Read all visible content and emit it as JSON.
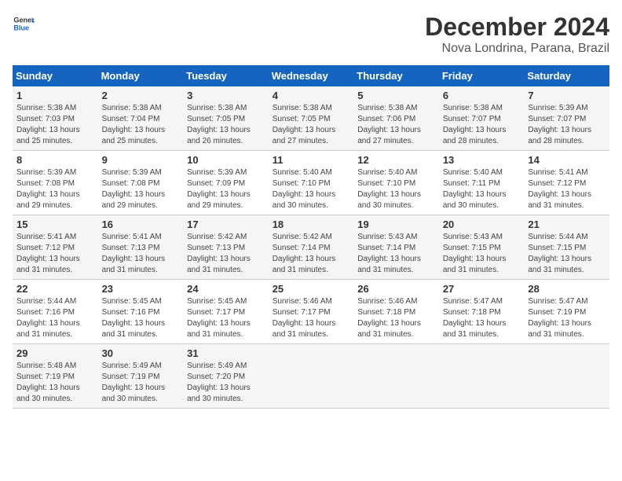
{
  "header": {
    "logo_line1": "General",
    "logo_line2": "Blue",
    "month_title": "December 2024",
    "location": "Nova Londrina, Parana, Brazil"
  },
  "weekdays": [
    "Sunday",
    "Monday",
    "Tuesday",
    "Wednesday",
    "Thursday",
    "Friday",
    "Saturday"
  ],
  "weeks": [
    [
      {
        "day": "1",
        "sunrise": "5:38 AM",
        "sunset": "7:03 PM",
        "daylight": "13 hours and 25 minutes."
      },
      {
        "day": "2",
        "sunrise": "5:38 AM",
        "sunset": "7:04 PM",
        "daylight": "13 hours and 25 minutes."
      },
      {
        "day": "3",
        "sunrise": "5:38 AM",
        "sunset": "7:05 PM",
        "daylight": "13 hours and 26 minutes."
      },
      {
        "day": "4",
        "sunrise": "5:38 AM",
        "sunset": "7:05 PM",
        "daylight": "13 hours and 27 minutes."
      },
      {
        "day": "5",
        "sunrise": "5:38 AM",
        "sunset": "7:06 PM",
        "daylight": "13 hours and 27 minutes."
      },
      {
        "day": "6",
        "sunrise": "5:38 AM",
        "sunset": "7:07 PM",
        "daylight": "13 hours and 28 minutes."
      },
      {
        "day": "7",
        "sunrise": "5:39 AM",
        "sunset": "7:07 PM",
        "daylight": "13 hours and 28 minutes."
      }
    ],
    [
      {
        "day": "8",
        "sunrise": "5:39 AM",
        "sunset": "7:08 PM",
        "daylight": "13 hours and 29 minutes."
      },
      {
        "day": "9",
        "sunrise": "5:39 AM",
        "sunset": "7:08 PM",
        "daylight": "13 hours and 29 minutes."
      },
      {
        "day": "10",
        "sunrise": "5:39 AM",
        "sunset": "7:09 PM",
        "daylight": "13 hours and 29 minutes."
      },
      {
        "day": "11",
        "sunrise": "5:40 AM",
        "sunset": "7:10 PM",
        "daylight": "13 hours and 30 minutes."
      },
      {
        "day": "12",
        "sunrise": "5:40 AM",
        "sunset": "7:10 PM",
        "daylight": "13 hours and 30 minutes."
      },
      {
        "day": "13",
        "sunrise": "5:40 AM",
        "sunset": "7:11 PM",
        "daylight": "13 hours and 30 minutes."
      },
      {
        "day": "14",
        "sunrise": "5:41 AM",
        "sunset": "7:12 PM",
        "daylight": "13 hours and 31 minutes."
      }
    ],
    [
      {
        "day": "15",
        "sunrise": "5:41 AM",
        "sunset": "7:12 PM",
        "daylight": "13 hours and 31 minutes."
      },
      {
        "day": "16",
        "sunrise": "5:41 AM",
        "sunset": "7:13 PM",
        "daylight": "13 hours and 31 minutes."
      },
      {
        "day": "17",
        "sunrise": "5:42 AM",
        "sunset": "7:13 PM",
        "daylight": "13 hours and 31 minutes."
      },
      {
        "day": "18",
        "sunrise": "5:42 AM",
        "sunset": "7:14 PM",
        "daylight": "13 hours and 31 minutes."
      },
      {
        "day": "19",
        "sunrise": "5:43 AM",
        "sunset": "7:14 PM",
        "daylight": "13 hours and 31 minutes."
      },
      {
        "day": "20",
        "sunrise": "5:43 AM",
        "sunset": "7:15 PM",
        "daylight": "13 hours and 31 minutes."
      },
      {
        "day": "21",
        "sunrise": "5:44 AM",
        "sunset": "7:15 PM",
        "daylight": "13 hours and 31 minutes."
      }
    ],
    [
      {
        "day": "22",
        "sunrise": "5:44 AM",
        "sunset": "7:16 PM",
        "daylight": "13 hours and 31 minutes."
      },
      {
        "day": "23",
        "sunrise": "5:45 AM",
        "sunset": "7:16 PM",
        "daylight": "13 hours and 31 minutes."
      },
      {
        "day": "24",
        "sunrise": "5:45 AM",
        "sunset": "7:17 PM",
        "daylight": "13 hours and 31 minutes."
      },
      {
        "day": "25",
        "sunrise": "5:46 AM",
        "sunset": "7:17 PM",
        "daylight": "13 hours and 31 minutes."
      },
      {
        "day": "26",
        "sunrise": "5:46 AM",
        "sunset": "7:18 PM",
        "daylight": "13 hours and 31 minutes."
      },
      {
        "day": "27",
        "sunrise": "5:47 AM",
        "sunset": "7:18 PM",
        "daylight": "13 hours and 31 minutes."
      },
      {
        "day": "28",
        "sunrise": "5:47 AM",
        "sunset": "7:19 PM",
        "daylight": "13 hours and 31 minutes."
      }
    ],
    [
      {
        "day": "29",
        "sunrise": "5:48 AM",
        "sunset": "7:19 PM",
        "daylight": "13 hours and 30 minutes."
      },
      {
        "day": "30",
        "sunrise": "5:49 AM",
        "sunset": "7:19 PM",
        "daylight": "13 hours and 30 minutes."
      },
      {
        "day": "31",
        "sunrise": "5:49 AM",
        "sunset": "7:20 PM",
        "daylight": "13 hours and 30 minutes."
      },
      null,
      null,
      null,
      null
    ]
  ],
  "labels": {
    "sunrise": "Sunrise: ",
    "sunset": "Sunset: ",
    "daylight": "Daylight: "
  }
}
